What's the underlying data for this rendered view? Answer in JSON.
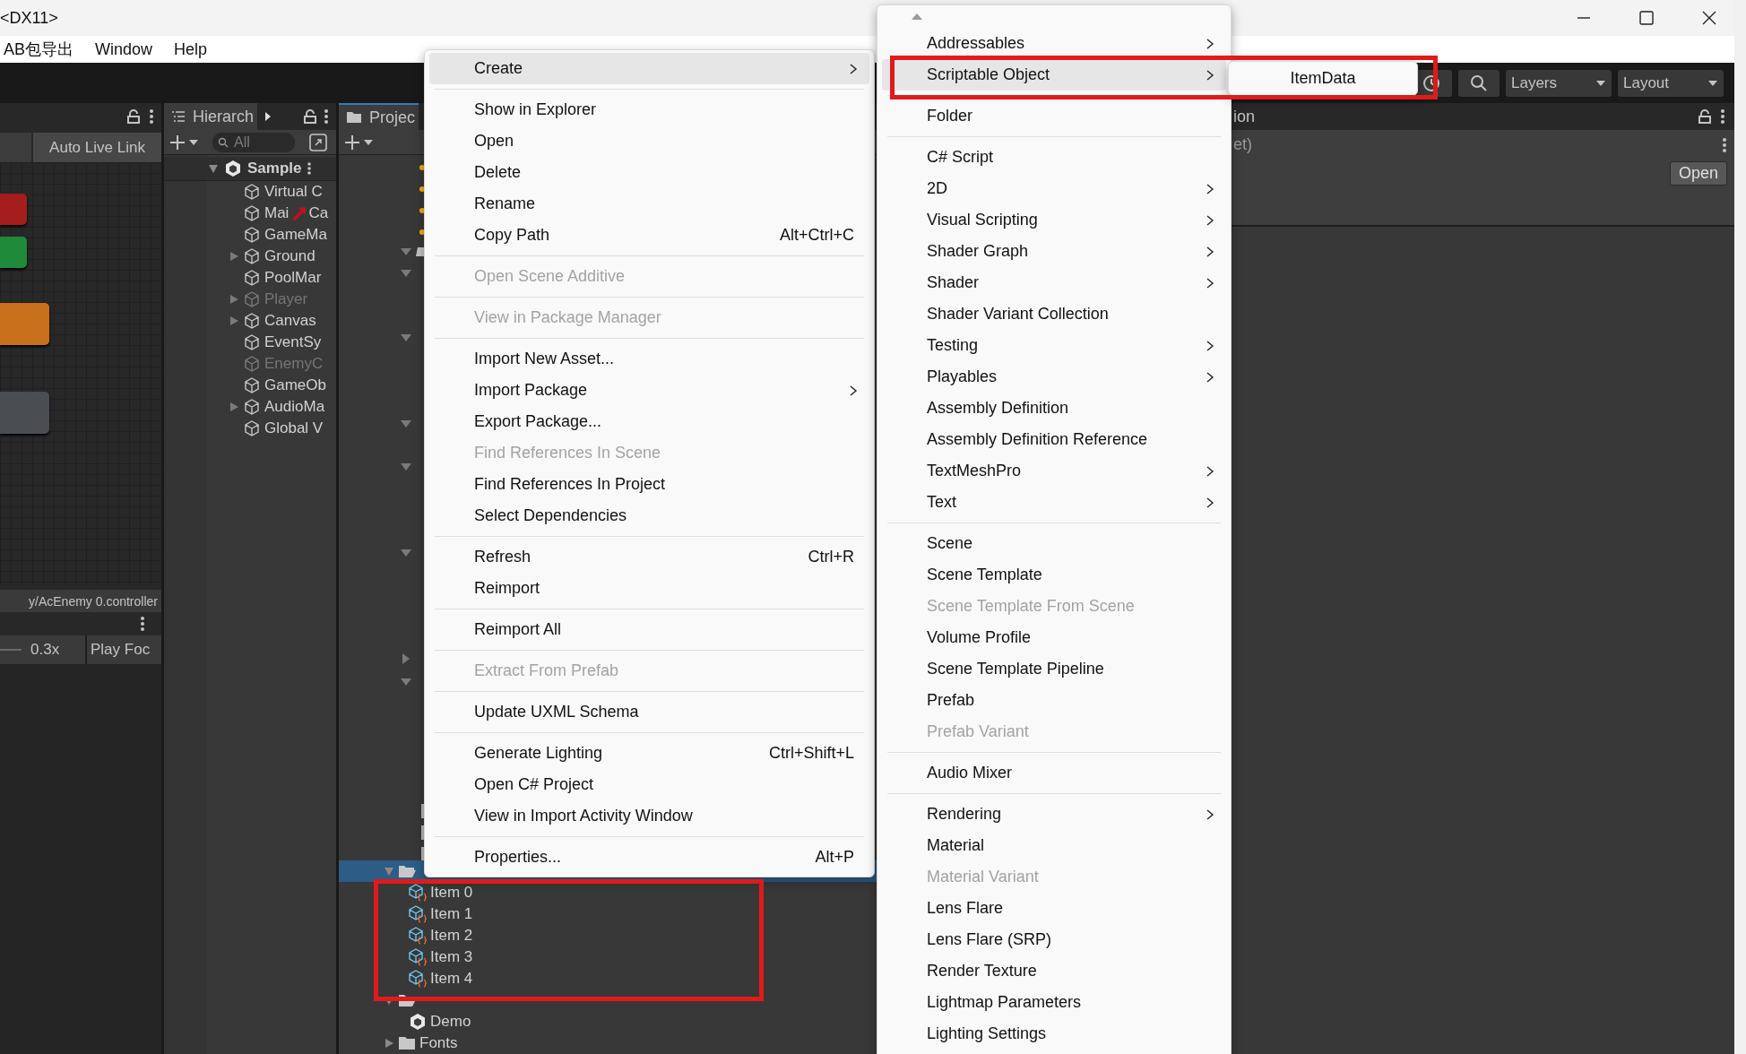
{
  "window": {
    "title": "<DX11>"
  },
  "menu_bar": [
    "AB包导出",
    "Window",
    "Help"
  ],
  "toolbar": {
    "layers": "Layers",
    "layout": "Layout"
  },
  "animator": {
    "auto_live_link": "Auto Live Link",
    "states": [
      {
        "color": "#a51d1d"
      },
      {
        "color": "#1f8a3a"
      },
      {
        "color": "#c9701c"
      },
      {
        "color": "#4a4d52"
      }
    ],
    "path": "y/AcEnemy 0.controller",
    "speed": "0.3x",
    "play_focus": "Play Foc"
  },
  "hierarchy": {
    "tab": "Hierarch",
    "search": {
      "placeholder": "All"
    },
    "scene": {
      "name": "Sample",
      "expanded": true,
      "children": [
        {
          "name": "Virtual C",
          "active": true
        },
        {
          "name": "Mai",
          "name_end": "Ca",
          "active": true
        },
        {
          "name": "GameMa",
          "active": true
        },
        {
          "name": "Ground",
          "active": true,
          "expanded": false
        },
        {
          "name": "PoolMar",
          "active": true
        },
        {
          "name": "Player",
          "active": false,
          "expanded": false
        },
        {
          "name": "Canvas",
          "active": true,
          "expanded": false
        },
        {
          "name": "EventSy",
          "active": true
        },
        {
          "name": "EnemyC",
          "active": false
        },
        {
          "name": "GameOb",
          "active": true
        },
        {
          "name": "AudioMa",
          "active": true,
          "expanded": false
        },
        {
          "name": "Global V",
          "active": true
        }
      ]
    }
  },
  "project": {
    "tab": "Projec",
    "rows": [
      {
        "kind": "folder",
        "expanded": true,
        "selected": true,
        "children": [
          {
            "name": "Item 0",
            "kind": "scriptable",
            "selected": false
          },
          {
            "name": "Item 1",
            "kind": "scriptable",
            "selected": false
          },
          {
            "name": "Item 2",
            "kind": "scriptable",
            "selected": false
          },
          {
            "name": "Item 3",
            "kind": "scriptable",
            "selected": false
          },
          {
            "name": "Item 4",
            "kind": "scriptable",
            "selected": false
          }
        ]
      },
      {
        "kind": "folder",
        "expanded": true,
        "selected": false,
        "children": [
          {
            "name": "Demo",
            "kind": "scene",
            "selected": false
          }
        ]
      },
      {
        "name": "Fonts",
        "kind": "folder",
        "expanded": false,
        "selected": false
      }
    ]
  },
  "inspector": {
    "title": "ion",
    "subtitle": "et)",
    "open_button": "Open"
  },
  "context_menu": {
    "items": [
      {
        "kind": "item",
        "label": "Create",
        "submenu": true,
        "selected": true,
        "disabled": false
      },
      {
        "kind": "separator"
      },
      {
        "kind": "item",
        "label": "Show in Explorer",
        "submenu": false,
        "selected": false,
        "disabled": false
      },
      {
        "kind": "item",
        "label": "Open",
        "submenu": false,
        "selected": false,
        "disabled": false
      },
      {
        "kind": "item",
        "label": "Delete",
        "submenu": false,
        "selected": false,
        "disabled": false
      },
      {
        "kind": "item",
        "label": "Rename",
        "submenu": false,
        "selected": false,
        "disabled": false
      },
      {
        "kind": "item",
        "label": "Copy Path",
        "shortcut": "Alt+Ctrl+C",
        "submenu": false,
        "selected": false,
        "disabled": false
      },
      {
        "kind": "separator"
      },
      {
        "kind": "item",
        "label": "Open Scene Additive",
        "submenu": false,
        "selected": false,
        "disabled": true
      },
      {
        "kind": "separator"
      },
      {
        "kind": "item",
        "label": "View in Package Manager",
        "submenu": false,
        "selected": false,
        "disabled": true
      },
      {
        "kind": "separator"
      },
      {
        "kind": "item",
        "label": "Import New Asset...",
        "submenu": false,
        "selected": false,
        "disabled": false
      },
      {
        "kind": "item",
        "label": "Import Package",
        "submenu": true,
        "selected": false,
        "disabled": false
      },
      {
        "kind": "item",
        "label": "Export Package...",
        "submenu": false,
        "selected": false,
        "disabled": false
      },
      {
        "kind": "item",
        "label": "Find References In Scene",
        "submenu": false,
        "selected": false,
        "disabled": true
      },
      {
        "kind": "item",
        "label": "Find References In Project",
        "submenu": false,
        "selected": false,
        "disabled": false
      },
      {
        "kind": "item",
        "label": "Select Dependencies",
        "submenu": false,
        "selected": false,
        "disabled": false
      },
      {
        "kind": "separator"
      },
      {
        "kind": "item",
        "label": "Refresh",
        "shortcut": "Ctrl+R",
        "submenu": false,
        "selected": false,
        "disabled": false
      },
      {
        "kind": "item",
        "label": "Reimport",
        "submenu": false,
        "selected": false,
        "disabled": false
      },
      {
        "kind": "separator"
      },
      {
        "kind": "item",
        "label": "Reimport All",
        "submenu": false,
        "selected": false,
        "disabled": false
      },
      {
        "kind": "separator"
      },
      {
        "kind": "item",
        "label": "Extract From Prefab",
        "submenu": false,
        "selected": false,
        "disabled": true
      },
      {
        "kind": "separator"
      },
      {
        "kind": "item",
        "label": "Update UXML Schema",
        "submenu": false,
        "selected": false,
        "disabled": false
      },
      {
        "kind": "separator"
      },
      {
        "kind": "item",
        "label": "Generate Lighting",
        "shortcut": "Ctrl+Shift+L",
        "submenu": false,
        "selected": false,
        "disabled": false
      },
      {
        "kind": "item",
        "label": "Open C# Project",
        "submenu": false,
        "selected": false,
        "disabled": false
      },
      {
        "kind": "item",
        "label": "View in Import Activity Window",
        "submenu": false,
        "selected": false,
        "disabled": false
      },
      {
        "kind": "separator"
      },
      {
        "kind": "item",
        "label": "Properties...",
        "shortcut": "Alt+P",
        "submenu": false,
        "selected": false,
        "disabled": false
      }
    ]
  },
  "create_menu": {
    "items": [
      {
        "kind": "item",
        "label": "Addressables",
        "submenu": true,
        "selected": false,
        "disabled": false
      },
      {
        "kind": "item",
        "label": "Scriptable Object",
        "submenu": true,
        "selected": true,
        "disabled": false
      },
      {
        "kind": "separator"
      },
      {
        "kind": "item",
        "label": "Folder",
        "submenu": false,
        "selected": false,
        "disabled": false
      },
      {
        "kind": "separator"
      },
      {
        "kind": "item",
        "label": "C# Script",
        "submenu": false,
        "selected": false,
        "disabled": false
      },
      {
        "kind": "item",
        "label": "2D",
        "submenu": true,
        "selected": false,
        "disabled": false
      },
      {
        "kind": "item",
        "label": "Visual Scripting",
        "submenu": true,
        "selected": false,
        "disabled": false
      },
      {
        "kind": "item",
        "label": "Shader Graph",
        "submenu": true,
        "selected": false,
        "disabled": false
      },
      {
        "kind": "item",
        "label": "Shader",
        "submenu": true,
        "selected": false,
        "disabled": false
      },
      {
        "kind": "item",
        "label": "Shader Variant Collection",
        "submenu": false,
        "selected": false,
        "disabled": false
      },
      {
        "kind": "item",
        "label": "Testing",
        "submenu": true,
        "selected": false,
        "disabled": false
      },
      {
        "kind": "item",
        "label": "Playables",
        "submenu": true,
        "selected": false,
        "disabled": false
      },
      {
        "kind": "item",
        "label": "Assembly Definition",
        "submenu": false,
        "selected": false,
        "disabled": false
      },
      {
        "kind": "item",
        "label": "Assembly Definition Reference",
        "submenu": false,
        "selected": false,
        "disabled": false
      },
      {
        "kind": "item",
        "label": "TextMeshPro",
        "submenu": true,
        "selected": false,
        "disabled": false
      },
      {
        "kind": "item",
        "label": "Text",
        "submenu": true,
        "selected": false,
        "disabled": false
      },
      {
        "kind": "separator"
      },
      {
        "kind": "item",
        "label": "Scene",
        "submenu": false,
        "selected": false,
        "disabled": false
      },
      {
        "kind": "item",
        "label": "Scene Template",
        "submenu": false,
        "selected": false,
        "disabled": false
      },
      {
        "kind": "item",
        "label": "Scene Template From Scene",
        "submenu": false,
        "selected": false,
        "disabled": true
      },
      {
        "kind": "item",
        "label": "Volume Profile",
        "submenu": false,
        "selected": false,
        "disabled": false
      },
      {
        "kind": "item",
        "label": "Scene Template Pipeline",
        "submenu": false,
        "selected": false,
        "disabled": false
      },
      {
        "kind": "item",
        "label": "Prefab",
        "submenu": false,
        "selected": false,
        "disabled": false
      },
      {
        "kind": "item",
        "label": "Prefab Variant",
        "submenu": false,
        "selected": false,
        "disabled": true
      },
      {
        "kind": "separator"
      },
      {
        "kind": "item",
        "label": "Audio Mixer",
        "submenu": false,
        "selected": false,
        "disabled": false
      },
      {
        "kind": "separator"
      },
      {
        "kind": "item",
        "label": "Rendering",
        "submenu": true,
        "selected": false,
        "disabled": false
      },
      {
        "kind": "item",
        "label": "Material",
        "submenu": false,
        "selected": false,
        "disabled": false
      },
      {
        "kind": "item",
        "label": "Material Variant",
        "submenu": false,
        "selected": false,
        "disabled": true
      },
      {
        "kind": "item",
        "label": "Lens Flare",
        "submenu": false,
        "selected": false,
        "disabled": false
      },
      {
        "kind": "item",
        "label": "Lens Flare (SRP)",
        "submenu": false,
        "selected": false,
        "disabled": false
      },
      {
        "kind": "item",
        "label": "Render Texture",
        "submenu": false,
        "selected": false,
        "disabled": false
      },
      {
        "kind": "item",
        "label": "Lightmap Parameters",
        "submenu": false,
        "selected": false,
        "disabled": false
      },
      {
        "kind": "item",
        "label": "Lighting Settings",
        "submenu": false,
        "selected": false,
        "disabled": false
      }
    ]
  },
  "scriptable_menu": {
    "items": [
      {
        "label": "ItemData",
        "selected": false
      }
    ]
  }
}
